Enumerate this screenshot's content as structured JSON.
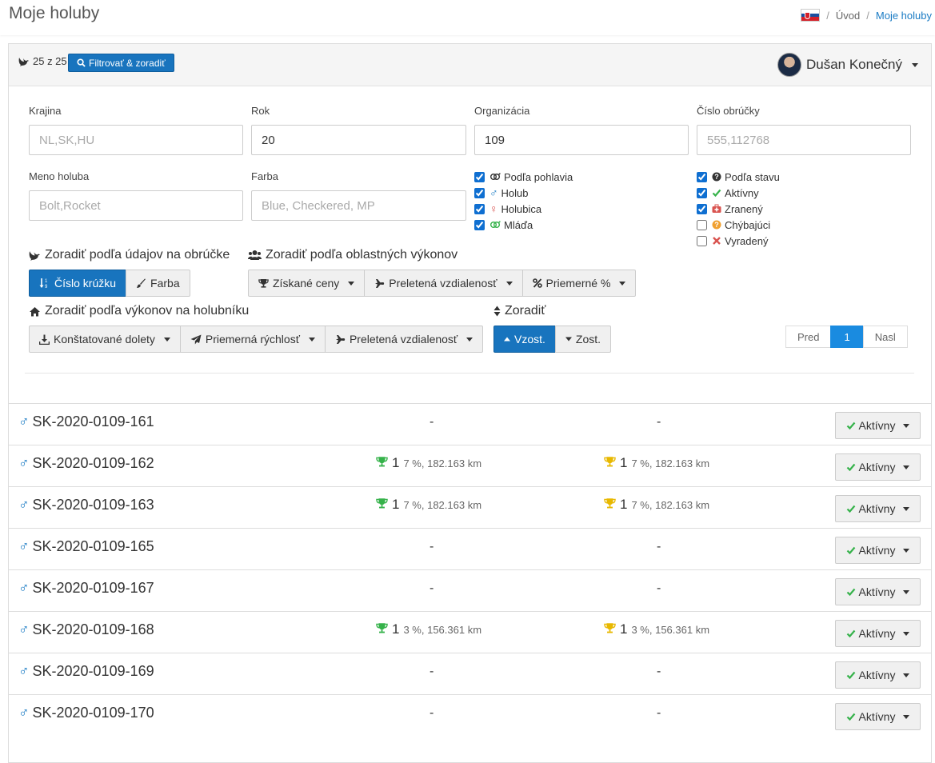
{
  "header": {
    "title": "Moje holuby",
    "breadcrumb": {
      "home": "Úvod",
      "current": "Moje holuby",
      "separator": "/"
    }
  },
  "toolbar": {
    "count": "25 z 25",
    "filter_button": "Filtrovať & zoradiť",
    "user_name": "Dušan Konečný"
  },
  "filters": {
    "country": {
      "label": "Krajina",
      "value": "",
      "placeholder": "NL,SK,HU"
    },
    "year": {
      "label": "Rok",
      "value": "20",
      "placeholder": ""
    },
    "organization": {
      "label": "Organizácia",
      "value": "109",
      "placeholder": ""
    },
    "ring_number": {
      "label": "Číslo obrúčky",
      "value": "",
      "placeholder": "555,112768"
    },
    "pigeon_name": {
      "label": "Meno holuba",
      "value": "",
      "placeholder": "Bolt,Rocket"
    },
    "color": {
      "label": "Farba",
      "value": "",
      "placeholder": "Blue, Checkered, MP"
    },
    "sex": [
      {
        "label": "Podľa pohlavia",
        "checked": true,
        "icon": "gender-icon"
      },
      {
        "label": "Holub",
        "checked": true,
        "icon": "male-icon"
      },
      {
        "label": "Holubica",
        "checked": true,
        "icon": "female-icon"
      },
      {
        "label": "Mláďa",
        "checked": true,
        "icon": "young-icon"
      }
    ],
    "status": [
      {
        "label": "Podľa stavu",
        "checked": true,
        "icon": "question-icon"
      },
      {
        "label": "Aktívny",
        "checked": true,
        "icon": "check-icon"
      },
      {
        "label": "Zranený",
        "checked": true,
        "icon": "medkit-icon"
      },
      {
        "label": "Chýbajúci",
        "checked": false,
        "icon": "question-circle-icon"
      },
      {
        "label": "Vyradený",
        "checked": false,
        "icon": "times-icon"
      }
    ]
  },
  "sort": {
    "ring_section": "Zoradiť podľa údajov na obrúčke",
    "ring_buttons": [
      "Číslo krúžku",
      "Farba"
    ],
    "region_section": "Zoradiť podľa oblastných výkonov",
    "region_buttons": [
      "Získané ceny",
      "Preletená vzdialenosť",
      "Priemerné %"
    ],
    "loft_section": "Zoradiť podľa výkonov na holubníku",
    "loft_buttons": [
      "Konštatované dolety",
      "Priemerná rýchlosť",
      "Preletená vzdialenosť"
    ],
    "order_section": "Zoradiť",
    "order_buttons": [
      "Vzost.",
      "Zost."
    ]
  },
  "pagination": {
    "prev": "Pred",
    "current": "1",
    "next": "Nasl"
  },
  "rows": [
    {
      "ring": "SK-2020-0109-161",
      "c1": null,
      "c2": null,
      "status": "Aktívny"
    },
    {
      "ring": "SK-2020-0109-162",
      "c1": {
        "count": "1",
        "detail": "7 %, 182.163 km"
      },
      "c2": {
        "count": "1",
        "detail": "7 %, 182.163 km"
      },
      "status": "Aktívny"
    },
    {
      "ring": "SK-2020-0109-163",
      "c1": {
        "count": "1",
        "detail": "7 %, 182.163 km"
      },
      "c2": {
        "count": "1",
        "detail": "7 %, 182.163 km"
      },
      "status": "Aktívny"
    },
    {
      "ring": "SK-2020-0109-165",
      "c1": null,
      "c2": null,
      "status": "Aktívny"
    },
    {
      "ring": "SK-2020-0109-167",
      "c1": null,
      "c2": null,
      "status": "Aktívny"
    },
    {
      "ring": "SK-2020-0109-168",
      "c1": {
        "count": "1",
        "detail": "3 %, 156.361 km"
      },
      "c2": {
        "count": "1",
        "detail": "3 %, 156.361 km"
      },
      "status": "Aktívny"
    },
    {
      "ring": "SK-2020-0109-169",
      "c1": null,
      "c2": null,
      "status": "Aktívny"
    },
    {
      "ring": "SK-2020-0109-170",
      "c1": null,
      "c2": null,
      "status": "Aktívny"
    }
  ],
  "empty_value": "-",
  "colors": {
    "primary": "#1874be",
    "trophy_green": "#35b24a",
    "trophy_gold": "#e8b800",
    "male": "#1a7bc4"
  }
}
